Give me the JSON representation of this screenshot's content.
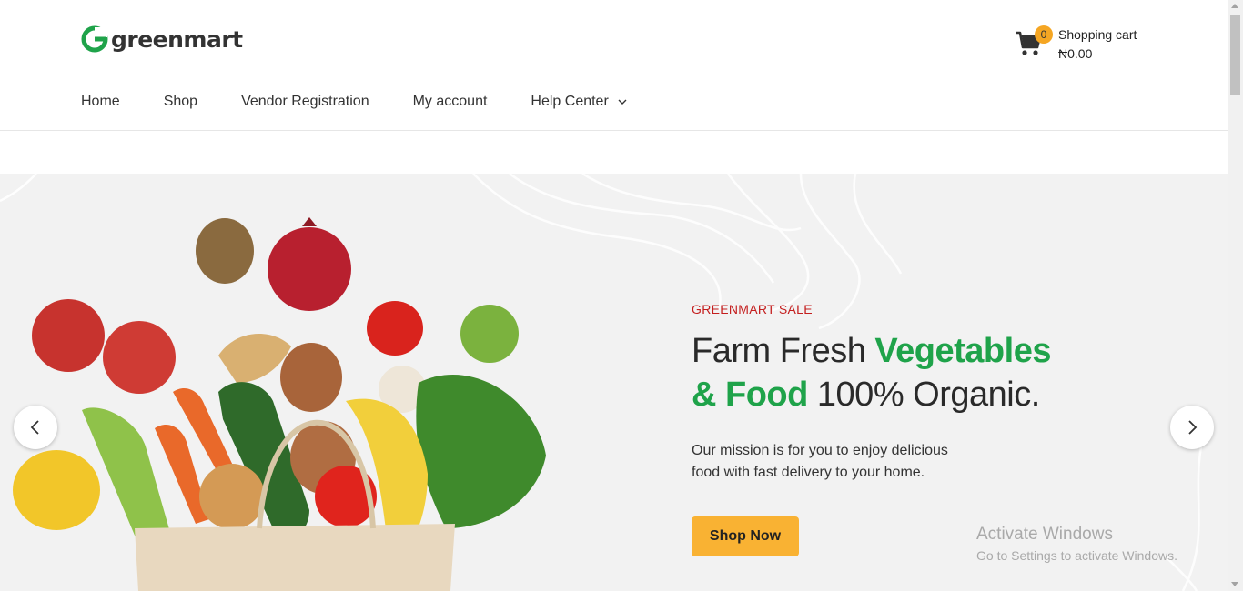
{
  "brand": {
    "name": "greenmart",
    "accent": "#1fa34a"
  },
  "cart": {
    "count": "0",
    "title": "Shopping cart",
    "amount": "₦0.00",
    "icon": "cart-icon"
  },
  "nav": {
    "items": [
      {
        "label": "Home"
      },
      {
        "label": "Shop"
      },
      {
        "label": "Vendor Registration"
      },
      {
        "label": "My account"
      },
      {
        "label": "Help Center"
      }
    ]
  },
  "hero": {
    "eyebrow": "GREENMART SALE",
    "headline_part1": "Farm Fresh ",
    "headline_green1": "Vegetables",
    "headline_green2": "& Food",
    "headline_part2": " 100% Organic.",
    "description": "Our mission is for you to enjoy delicious food with fast delivery to your home.",
    "button_label": "Shop Now",
    "button_color": "#f9b233",
    "eyebrow_color": "#c41e1e"
  },
  "watermark": {
    "title": "Activate Windows",
    "subtitle": "Go to Settings to activate Windows."
  }
}
